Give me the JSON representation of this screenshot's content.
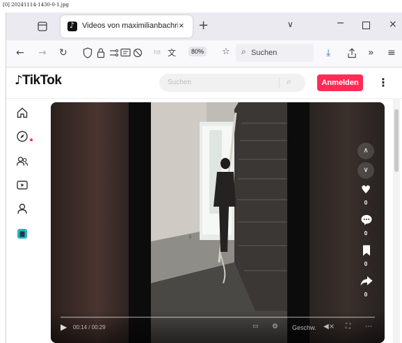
{
  "caption": "[0] 20241114-1430-0-1.jpg",
  "browser": {
    "tab_title": "Videos von maximilianbachring",
    "tab_close": "×",
    "new_tab": "+",
    "tab_overflow": "∨",
    "win_min": "–",
    "win_close": "×",
    "nav": {
      "back": "←",
      "forward": "→",
      "reload": "↻",
      "url_text": "htt",
      "zoom": "80%",
      "search_label": "Suchen",
      "download": "⤓",
      "extensions": "»",
      "menu": "≡"
    }
  },
  "tiktok": {
    "logo": "TikTok",
    "search_placeholder": "Suchen",
    "login_label": "Anmelden",
    "more": "⋮"
  },
  "video": {
    "time": "00:14 / 00:29",
    "caption_label": "Geschw.",
    "counts": {
      "likes": "0",
      "comments": "0",
      "saves": "0",
      "shares": "0"
    }
  },
  "colors": {
    "accent": "#fe2c55",
    "tabbar": "#ebeaf1"
  }
}
